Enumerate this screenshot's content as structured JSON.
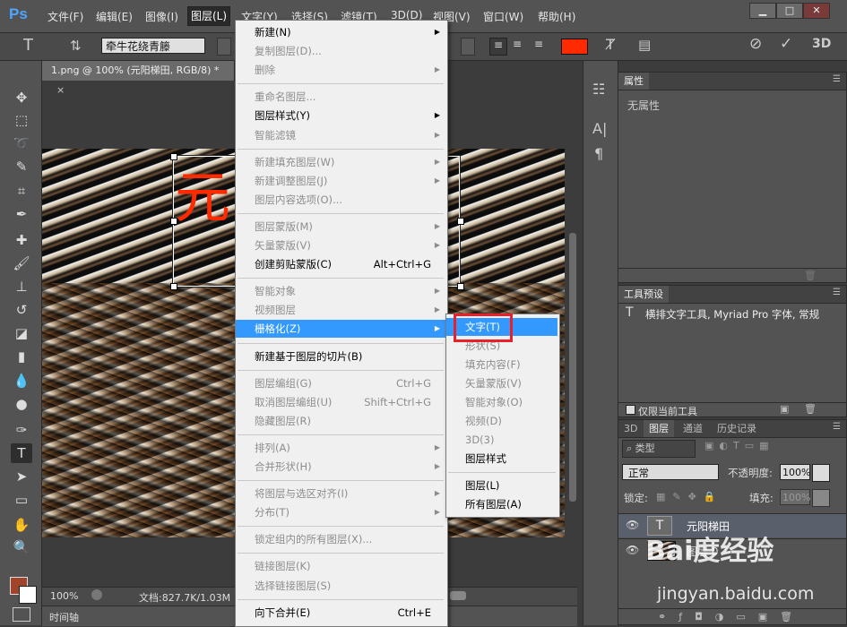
{
  "app": {
    "logo": "Ps"
  },
  "menubar": [
    "文件(F)",
    "编辑(E)",
    "图像(I)",
    "图层(L)",
    "文字(Y)",
    "选择(S)",
    "滤镜(T)",
    "3D(D)",
    "视图(V)",
    "窗口(W)",
    "帮助(H)"
  ],
  "window_buttons": [
    "▁",
    "□",
    "✕"
  ],
  "options": {
    "font_family": "牵牛花绕青籐",
    "color": "#ff2a00"
  },
  "document": {
    "tab_title": "1.png @ 100% (元阳梯田, RGB/8) *",
    "canvas_text": "元",
    "zoom": "100%",
    "doc_info": "文档:827.7K/1.03M"
  },
  "timeline_label": "时间轴",
  "properties_panel": {
    "title": "属性",
    "content": "无属性"
  },
  "tool_presets_panel": {
    "title": "工具预设",
    "item": "横排文字工具, Myriad Pro 字体, 常规",
    "checkbox_label": "仅限当前工具"
  },
  "layers_panel": {
    "tabs": [
      "3D",
      "图层",
      "通道",
      "历史记录"
    ],
    "filter_label": "类型",
    "blend_mode": "正常",
    "opacity_label": "不透明度:",
    "opacity_value": "100%",
    "lock_label": "锁定:",
    "fill_label": "填充:",
    "fill_value": "100%",
    "layers": [
      {
        "name": "元阳梯田",
        "type": "text",
        "selected": true
      },
      {
        "name": "图层 0",
        "type": "image",
        "selected": false
      }
    ]
  },
  "layer_menu": {
    "items": [
      {
        "label": "新建(N)",
        "enabled": true,
        "submenu": true
      },
      {
        "label": "复制图层(D)...",
        "enabled": false
      },
      {
        "label": "删除",
        "enabled": false,
        "submenu": true
      },
      {
        "sep": true
      },
      {
        "label": "重命名图层...",
        "enabled": false
      },
      {
        "label": "图层样式(Y)",
        "enabled": true,
        "submenu": true
      },
      {
        "label": "智能滤镜",
        "enabled": false,
        "submenu": true
      },
      {
        "sep": true
      },
      {
        "label": "新建填充图层(W)",
        "enabled": false,
        "submenu": true
      },
      {
        "label": "新建调整图层(J)",
        "enabled": false,
        "submenu": true
      },
      {
        "label": "图层内容选项(O)...",
        "enabled": false
      },
      {
        "sep": true
      },
      {
        "label": "图层蒙版(M)",
        "enabled": false,
        "submenu": true
      },
      {
        "label": "矢量蒙版(V)",
        "enabled": false,
        "submenu": true
      },
      {
        "label": "创建剪贴蒙版(C)",
        "enabled": true,
        "shortcut": "Alt+Ctrl+G"
      },
      {
        "sep": true
      },
      {
        "label": "智能对象",
        "enabled": false,
        "submenu": true
      },
      {
        "label": "视频图层",
        "enabled": false,
        "submenu": true
      },
      {
        "label": "栅格化(Z)",
        "enabled": true,
        "submenu": true,
        "highlighted": true
      },
      {
        "sep": true
      },
      {
        "label": "新建基于图层的切片(B)",
        "enabled": true
      },
      {
        "sep": true
      },
      {
        "label": "图层编组(G)",
        "enabled": false,
        "shortcut": "Ctrl+G"
      },
      {
        "label": "取消图层编组(U)",
        "enabled": false,
        "shortcut": "Shift+Ctrl+G"
      },
      {
        "label": "隐藏图层(R)",
        "enabled": false
      },
      {
        "sep": true
      },
      {
        "label": "排列(A)",
        "enabled": false,
        "submenu": true
      },
      {
        "label": "合并形状(H)",
        "enabled": false,
        "submenu": true
      },
      {
        "sep": true
      },
      {
        "label": "将图层与选区对齐(I)",
        "enabled": false,
        "submenu": true
      },
      {
        "label": "分布(T)",
        "enabled": false,
        "submenu": true
      },
      {
        "sep": true
      },
      {
        "label": "锁定组内的所有图层(X)...",
        "enabled": false
      },
      {
        "sep": true
      },
      {
        "label": "链接图层(K)",
        "enabled": false
      },
      {
        "label": "选择链接图层(S)",
        "enabled": false
      },
      {
        "sep": true
      },
      {
        "label": "向下合并(E)",
        "enabled": true,
        "shortcut": "Ctrl+E"
      }
    ]
  },
  "rasterize_submenu": {
    "items": [
      {
        "label": "文字(T)",
        "enabled": true,
        "highlighted": true
      },
      {
        "label": "形状(S)",
        "enabled": false
      },
      {
        "label": "填充内容(F)",
        "enabled": false
      },
      {
        "label": "矢量蒙版(V)",
        "enabled": false
      },
      {
        "label": "智能对象(O)",
        "enabled": false
      },
      {
        "label": "视频(D)",
        "enabled": false
      },
      {
        "label": "3D(3)",
        "enabled": false
      },
      {
        "label": "图层样式",
        "enabled": true
      },
      {
        "sep": true
      },
      {
        "label": "图层(L)",
        "enabled": true
      },
      {
        "label": "所有图层(A)",
        "enabled": true
      }
    ]
  },
  "watermark": {
    "brand": "Bai度经验",
    "url": "jingyan.baidu.com"
  },
  "tools": [
    "move-tool",
    "marquee-tool",
    "lasso-tool",
    "quick-select-tool",
    "crop-tool",
    "eyedropper-tool",
    "healing-tool",
    "brush-tool",
    "stamp-tool",
    "history-brush-tool",
    "eraser-tool",
    "gradient-tool",
    "blur-tool",
    "dodge-tool",
    "pen-tool",
    "type-tool",
    "path-select-tool",
    "shape-tool",
    "hand-tool",
    "zoom-tool"
  ]
}
